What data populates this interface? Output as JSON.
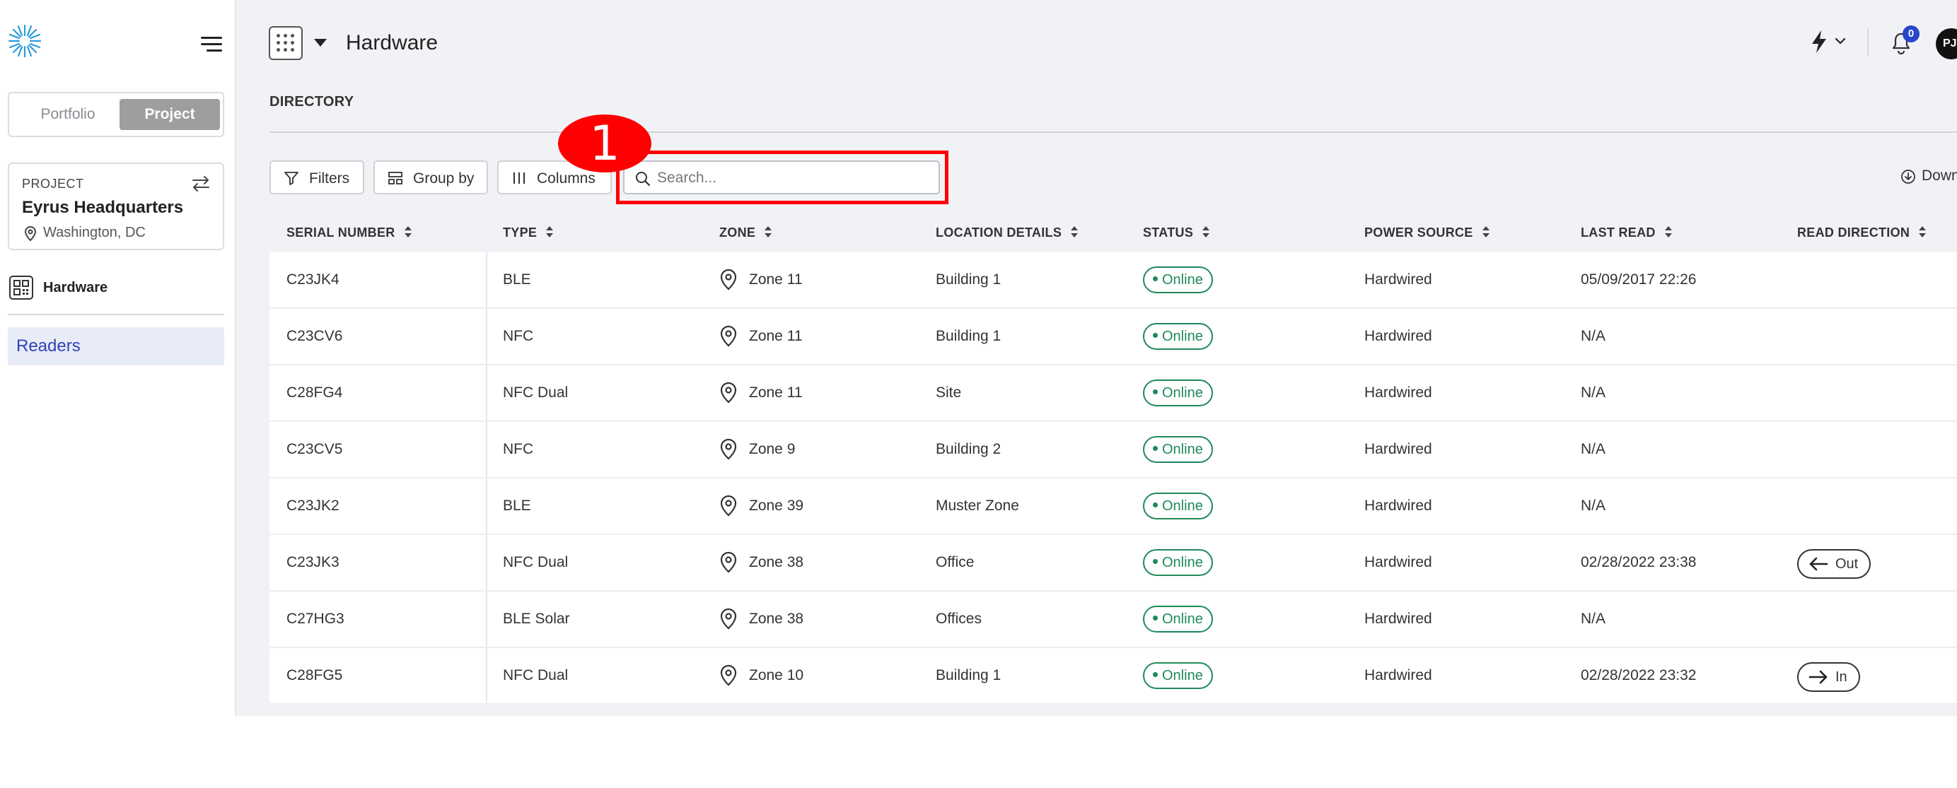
{
  "sidebar": {
    "logo_icon": "sunburst-logo-icon",
    "toggle": {
      "portfolio": "Portfolio",
      "project": "Project",
      "selected": "Project"
    },
    "project_card": {
      "label": "PROJECT",
      "name": "Eyrus Headquarters",
      "location": "Washington, DC"
    },
    "nav": [
      {
        "label": "Hardware",
        "icon": "qr-code-icon"
      }
    ],
    "sub_nav": [
      {
        "label": "Readers",
        "active": true
      }
    ]
  },
  "header": {
    "title": "Hardware",
    "notification_count": "0",
    "avatar_initials": "PJ"
  },
  "section": {
    "title": "DIRECTORY"
  },
  "toolbar": {
    "filters_label": "Filters",
    "group_by_label": "Group by",
    "columns_label": "Columns",
    "search_placeholder": "Search...",
    "download_label": "Download"
  },
  "annotation": {
    "number": "1",
    "color": "#ff0000"
  },
  "table": {
    "columns": [
      "SERIAL NUMBER",
      "TYPE",
      "ZONE",
      "LOCATION DETAILS",
      "STATUS",
      "POWER SOURCE",
      "LAST READ",
      "READ DIRECTION"
    ],
    "rows": [
      {
        "serial": "C23JK4",
        "type": "BLE",
        "zone": "Zone 11",
        "location": "Building 1",
        "status": "Online",
        "power": "Hardwired",
        "last_read": "05/09/2017 22:26",
        "direction": ""
      },
      {
        "serial": "C23CV6",
        "type": "NFC",
        "zone": "Zone 11",
        "location": "Building 1",
        "status": "Online",
        "power": "Hardwired",
        "last_read": "N/A",
        "direction": ""
      },
      {
        "serial": "C28FG4",
        "type": "NFC Dual",
        "zone": "Zone 11",
        "location": "Site",
        "status": "Online",
        "power": "Hardwired",
        "last_read": "N/A",
        "direction": ""
      },
      {
        "serial": "C23CV5",
        "type": "NFC",
        "zone": "Zone 9",
        "location": "Building 2",
        "status": "Online",
        "power": "Hardwired",
        "last_read": "N/A",
        "direction": ""
      },
      {
        "serial": "C23JK2",
        "type": "BLE",
        "zone": "Zone 39",
        "location": "Muster Zone",
        "status": "Online",
        "power": "Hardwired",
        "last_read": "N/A",
        "direction": ""
      },
      {
        "serial": "C23JK3",
        "type": "NFC Dual",
        "zone": "Zone 38",
        "location": "Office",
        "status": "Online",
        "power": "Hardwired",
        "last_read": "02/28/2022 23:38",
        "direction": "Out"
      },
      {
        "serial": "C27HG3",
        "type": "BLE Solar",
        "zone": "Zone 38",
        "location": "Offices",
        "status": "Online",
        "power": "Hardwired",
        "last_read": "N/A",
        "direction": ""
      },
      {
        "serial": "C28FG5",
        "type": "NFC Dual",
        "zone": "Zone 10",
        "location": "Building 1",
        "status": "Online",
        "power": "Hardwired",
        "last_read": "02/28/2022 23:32",
        "direction": "In"
      }
    ]
  },
  "colors": {
    "accent": "#2e45b4",
    "status_online": "#1f8a5a",
    "highlight": "#ff0000",
    "badge": "#2947c8"
  }
}
